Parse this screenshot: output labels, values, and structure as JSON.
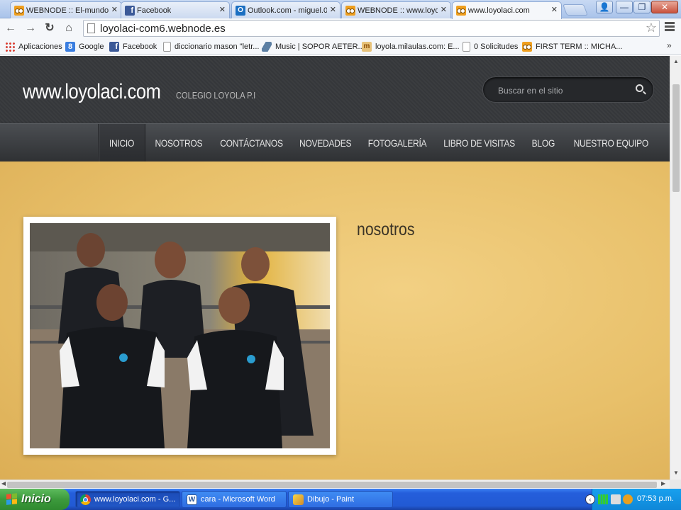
{
  "browser": {
    "tabs": [
      {
        "title": "WEBNODE :: El-mundo-",
        "icon": "webnode-icon",
        "active": false
      },
      {
        "title": "Facebook",
        "icon": "facebook-icon",
        "active": false
      },
      {
        "title": "Outlook.com - miguel.0",
        "icon": "outlook-icon",
        "active": false
      },
      {
        "title": "WEBNODE :: www.loyo",
        "icon": "webnode-icon",
        "active": false
      },
      {
        "title": "www.loyolaci.com",
        "icon": "webnode-icon",
        "active": true
      }
    ],
    "url": "loyolaci-com6.webnode.es",
    "bookmarks": [
      {
        "label": "Aplicaciones",
        "icon": "apps-icon"
      },
      {
        "label": "Google",
        "icon": "google-icon"
      },
      {
        "label": "Facebook",
        "icon": "facebook-icon"
      },
      {
        "label": "diccionario mason \"letr...",
        "icon": "page-icon"
      },
      {
        "label": "Music | SOPOR AETER...",
        "icon": "music-icon"
      },
      {
        "label": "loyola.milaulas.com: E...",
        "icon": "milaulas-icon"
      },
      {
        "label": "0 Solicitudes",
        "icon": "page-icon"
      },
      {
        "label": "FIRST TERM :: MICHA...",
        "icon": "webnode-icon"
      }
    ],
    "bookmarks_overflow": "»"
  },
  "site": {
    "title": "www.loyolaci.com",
    "slogan": "COLEGIO LOYOLA P.I",
    "search_placeholder": "Buscar en el sitio",
    "nav": [
      {
        "label": "INICIO",
        "active": true
      },
      {
        "label": "NOSOTROS",
        "active": false
      },
      {
        "label": "CONTÁCTANOS",
        "active": false
      },
      {
        "label": "NOVEDADES",
        "active": false
      },
      {
        "label": "FOTOGALERÍA",
        "active": false
      },
      {
        "label": "LIBRO DE VISITAS",
        "active": false
      },
      {
        "label": "BLOG",
        "active": false
      },
      {
        "label": "NUESTRO EQUIPO",
        "active": false
      }
    ],
    "section_heading": "nosotros"
  },
  "taskbar": {
    "start_label": "Inicio",
    "tasks": [
      {
        "label": "www.loyolaci.com - G...",
        "icon": "chrome-icon",
        "active": true
      },
      {
        "label": "cara - Microsoft Word",
        "icon": "word-icon",
        "active": false
      },
      {
        "label": "Dibujo - Paint",
        "icon": "paint-icon",
        "active": false
      }
    ],
    "clock": "07:53 p.m."
  },
  "colors": {
    "header_bg": "#3b3d40",
    "nav_bg": "#3e4145",
    "content_bg": "#e9c16a",
    "taskbar_blue": "#245edb",
    "start_green": "#3c9a3c"
  }
}
